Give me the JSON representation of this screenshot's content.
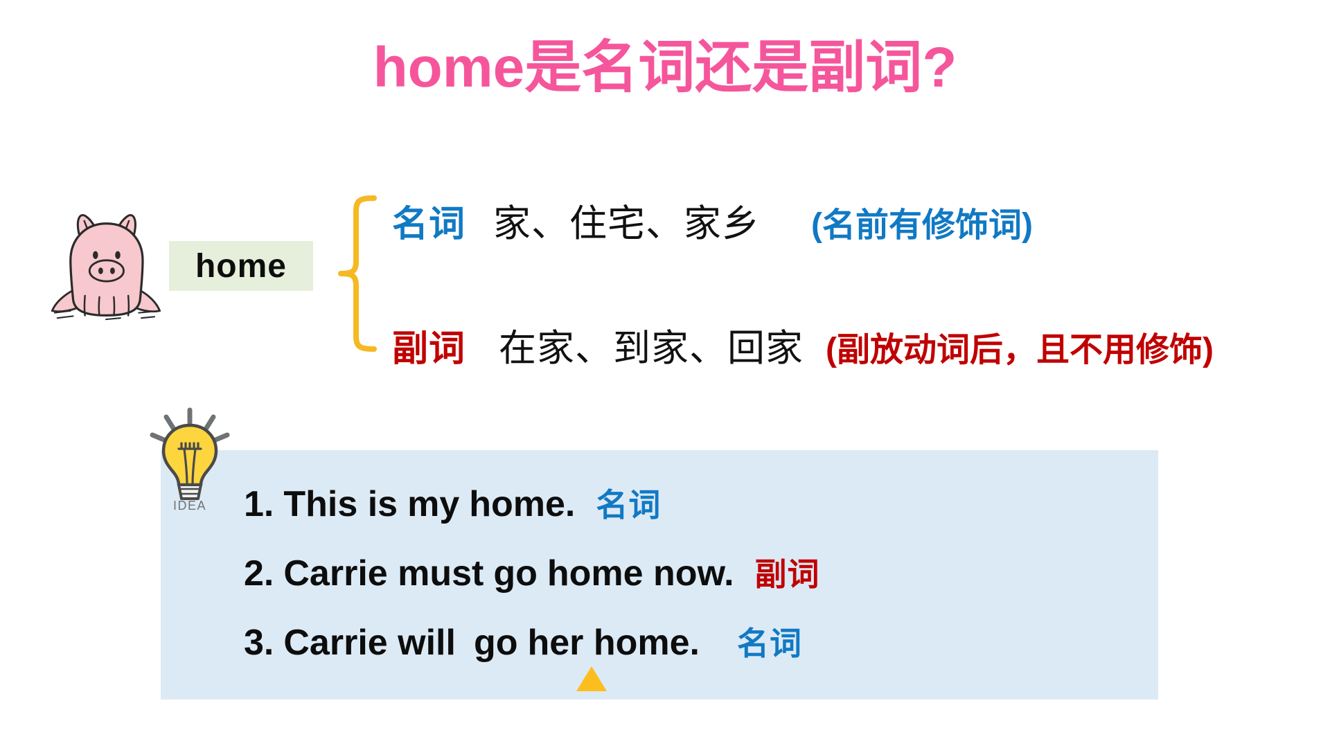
{
  "title": "home是名词还是副词?",
  "colors": {
    "title_pink": "#f5569b",
    "noun_blue": "#1179c4",
    "adverb_red": "#c00000",
    "brace_yellow": "#f5b923",
    "keyword_box_green": "#e6efdb",
    "panel_blue": "#dceaf5",
    "underline_green": "#1a9c5b",
    "triangle_yellow": "#fcbe1c",
    "pig_pink": "#f7c8cd"
  },
  "keyword": {
    "label": "home"
  },
  "pig": {
    "icon": "pig-icon"
  },
  "brace": {
    "icon": "curly-brace-icon"
  },
  "definitions": [
    {
      "pos": "名词",
      "meaning": "家、住宅、家乡",
      "note": "(名前有修饰词)"
    },
    {
      "pos": "副词",
      "meaning": "在家、到家、回家",
      "note": "(副放动词后，且不用修饰)"
    }
  ],
  "idea": {
    "icon": "lightbulb-icon",
    "caption": "IDEA"
  },
  "examples": [
    {
      "number": "1.",
      "before": "This is",
      "underlined": "my",
      "after": "home.",
      "tag": "名词"
    },
    {
      "number": "2.",
      "before": "Carrie must",
      "underlined": "go",
      "after": "home now.",
      "tag": "副词"
    },
    {
      "number": "3.",
      "before": "Carrie will",
      "underlined": "go",
      "after": "her home.",
      "tag": "名词"
    }
  ],
  "marker": {
    "icon": "triangle-up-icon"
  }
}
